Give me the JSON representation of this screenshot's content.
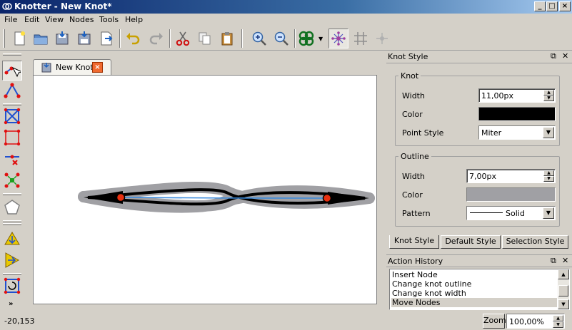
{
  "window": {
    "title": "Knotter - New Knot*",
    "minimize": "_",
    "maximize": "□",
    "close": "×"
  },
  "menu": [
    "File",
    "Edit",
    "View",
    "Nodes",
    "Tools",
    "Help"
  ],
  "document": {
    "tab_label": "New Knot",
    "tab_close": "×"
  },
  "knot_style_panel": {
    "title": "Knot Style",
    "knot_group": "Knot",
    "knot_width_label": "Width",
    "knot_width": "11,00px",
    "knot_color_label": "Color",
    "knot_color": "#000000",
    "point_style_label": "Point Style",
    "point_style": "Miter",
    "outline_group": "Outline",
    "outline_width_label": "Width",
    "outline_width": "7,00px",
    "outline_color_label": "Color",
    "outline_color": "#a0a0a4",
    "pattern_label": "Pattern",
    "pattern": "Solid",
    "tabs": [
      "Knot Style",
      "Default Style",
      "Selection Style"
    ]
  },
  "action_history": {
    "title": "Action History",
    "items": [
      "Insert Node",
      "Change knot outline",
      "Change knot width",
      "Move Nodes"
    ],
    "selected_index": 3
  },
  "status": {
    "coords": "-20,153",
    "zoom_button": "Zoom",
    "zoom_value": "100,00%"
  },
  "icons": {
    "dock_float": "⧉",
    "dock_close": "✕",
    "spin_up": "▲",
    "spin_down": "▼",
    "drop": "▼"
  }
}
